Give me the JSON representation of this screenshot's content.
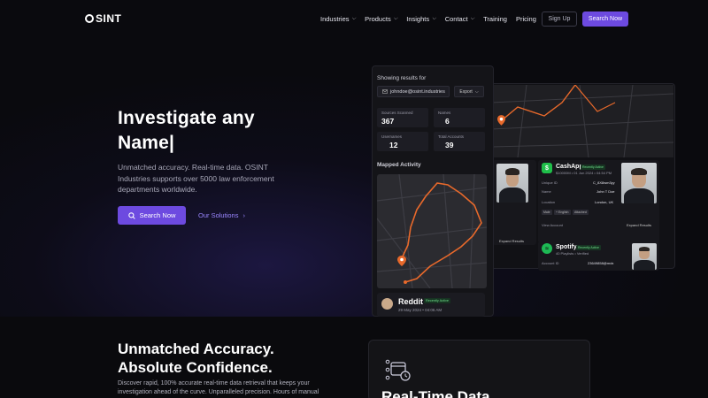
{
  "nav": {
    "logo": "OSINT",
    "items": [
      {
        "label": "Industries",
        "dropdown": true
      },
      {
        "label": "Products",
        "dropdown": true
      },
      {
        "label": "Insights",
        "dropdown": true
      },
      {
        "label": "Contact",
        "dropdown": true
      },
      {
        "label": "Training",
        "dropdown": false
      },
      {
        "label": "Pricing",
        "dropdown": false
      }
    ],
    "sign_up": "Sign Up",
    "search_now": "Search Now"
  },
  "hero": {
    "title_line1": "Investigate any",
    "title_line2": "Name|",
    "subtitle": "Unmatched accuracy. Real-time data. OSINT Industries supports over 5000 law enforcement departments worldwide.",
    "cta_primary": "Search Now",
    "cta_secondary": "Our Solutions"
  },
  "app": {
    "showing_results": "Showing results for",
    "email": "johndoe@osint.industries",
    "export_label": "Export",
    "stats": [
      {
        "label": "Sources Scanned",
        "value": "367"
      },
      {
        "label": "Names",
        "value": "6"
      },
      {
        "label": "Usernames",
        "value": "12"
      },
      {
        "label": "Total Accounts",
        "value": "39"
      }
    ],
    "mapped_activity": "Mapped Activity",
    "reddit": {
      "name": "Reddit",
      "badge": "Recently Active",
      "date": "29 May 2024 • 04:06 AM"
    },
    "cashapp": {
      "name": "CashApp",
      "badge": "Recently Active",
      "meta": "$10000M • 01 Jun 2024 • 04:54 PM",
      "fields": [
        {
          "k": "Unique ID",
          "v": "C_8X8wm3yy"
        },
        {
          "k": "Name",
          "v": "John T Doe"
        },
        {
          "k": "Location",
          "v": "London, UK"
        }
      ],
      "chips": [
        "Male",
        "+ English",
        "Attached"
      ],
      "view_account": "View Account",
      "expand": "Expand Results",
      "expand_left": "Expand Results"
    },
    "spotify": {
      "name": "Spotify",
      "badge": "Recently Active",
      "meta": "40 Playlists • Verified",
      "fields": [
        {
          "k": "Account ID",
          "v": "23649858@mdx"
        }
      ]
    }
  },
  "lower": {
    "title_line1": "Unmatched Accuracy.",
    "title_line2": "Absolute Confidence.",
    "subtitle": "Discover rapid, 100% accurate real-time data retrieval that keeps your investigation ahead of the curve. Unparalleled precision. Hours of manual",
    "card_title": "Real-Time Data"
  }
}
